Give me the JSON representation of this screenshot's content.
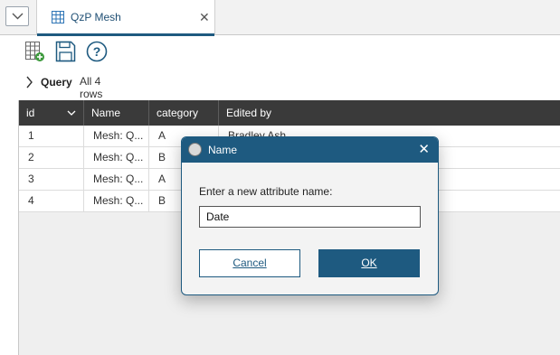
{
  "tab": {
    "title": "QzP Mesh"
  },
  "query": {
    "label": "Query",
    "summary": "All 4 rows"
  },
  "grid": {
    "columns": [
      "id",
      "Name",
      "category",
      "Edited by"
    ],
    "rows": [
      {
        "id": "1",
        "name": "Mesh: Q...",
        "category": "A",
        "edited_by": "Bradley Ash"
      },
      {
        "id": "2",
        "name": "Mesh: Q...",
        "category": "B",
        "edited_by": ""
      },
      {
        "id": "3",
        "name": "Mesh: Q...",
        "category": "A",
        "edited_by": ""
      },
      {
        "id": "4",
        "name": "Mesh: Q...",
        "category": "B",
        "edited_by": ""
      }
    ]
  },
  "dialog": {
    "title": "Name",
    "prompt": "Enter a new attribute name:",
    "input_value": "Date",
    "cancel_label": "Cancel",
    "ok_label": "OK"
  },
  "icons": {
    "dropdown": "chevron-down-icon",
    "tab": "table-icon",
    "close": "close-icon",
    "add_column": "add-column-icon",
    "save": "save-icon",
    "help": "help-icon",
    "expand": "chevron-right-icon",
    "app": "app-icon"
  },
  "colors": {
    "accent": "#1e5a80",
    "header_bg": "#3a3a3a"
  }
}
